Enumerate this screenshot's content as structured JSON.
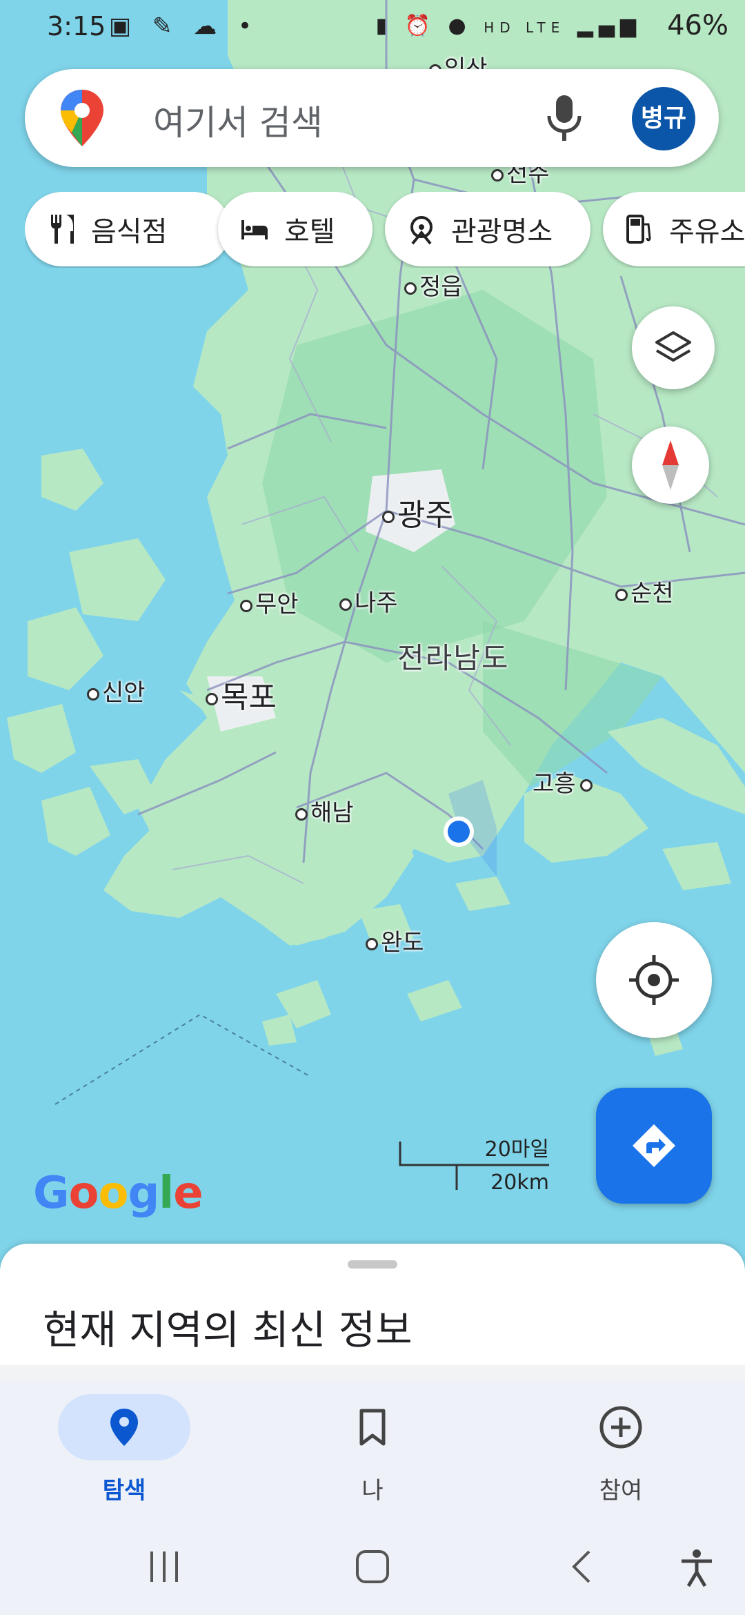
{
  "status_bar": {
    "time": "3:15",
    "left_icons": [
      "gallery-icon",
      "app-icon",
      "app-icon",
      "dot"
    ],
    "network": "HD LTE",
    "battery": "46%"
  },
  "search": {
    "placeholder": "여기서 검색",
    "avatar_text": "병규"
  },
  "chips": [
    {
      "label": "음식점",
      "icon": "fork-knife-icon"
    },
    {
      "label": "호텔",
      "icon": "bed-icon"
    },
    {
      "label": "관광명소",
      "icon": "attraction-icon"
    },
    {
      "label": "주유소",
      "icon": "gas-station-icon"
    }
  ],
  "map": {
    "labels": {
      "iksan": "익산",
      "jeonju": "전주",
      "jeongeup": "정읍",
      "gwangju": "광주",
      "muan": "무안",
      "naju": "나주",
      "suncheon": "순천",
      "region": "전라남도",
      "sinan": "신안",
      "mokpo": "목포",
      "goheung": "고흥",
      "haenam": "해남",
      "wando": "완도"
    },
    "scale": {
      "miles": "20마일",
      "km": "20km"
    },
    "logo": "Google"
  },
  "sheet": {
    "title": "현재 지역의 최신 정보"
  },
  "bottom_nav": [
    {
      "label": "탐색",
      "icon": "location-pin-icon",
      "active": true
    },
    {
      "label": "나",
      "icon": "bookmark-icon",
      "active": false
    },
    {
      "label": "참여",
      "icon": "add-circle-icon",
      "active": false
    }
  ]
}
